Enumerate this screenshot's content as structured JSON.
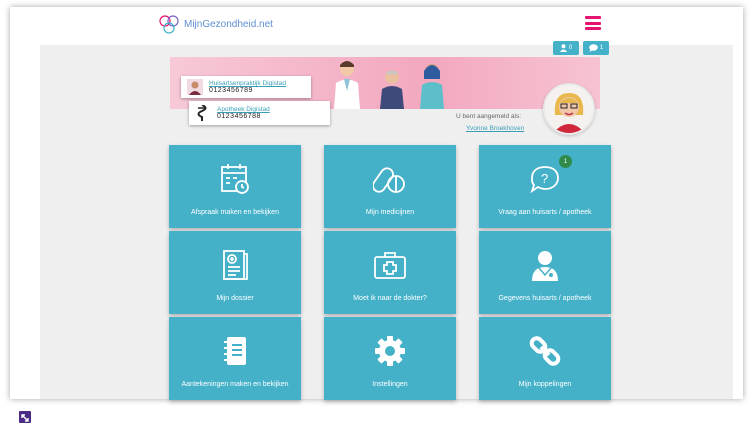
{
  "header": {
    "logo_text": "MijnGezondheid.net",
    "brand_color": "#e5156f",
    "accent_color": "#45b1c9"
  },
  "notifications": {
    "alerts_count": "0",
    "messages_count": "1"
  },
  "contacts": [
    {
      "name": "Huisartsenpraktijk Digistad",
      "phone": "0123456789"
    },
    {
      "name": "Apotheek Digistad",
      "phone": "0123456788"
    }
  ],
  "login": {
    "label": "U bent aangemeld als:",
    "user_name": "Yvonne Broekhoven"
  },
  "tiles": [
    {
      "label": "Afspraak maken en bekijken",
      "icon": "calendar-icon"
    },
    {
      "label": "Mijn medicijnen",
      "icon": "pills-icon"
    },
    {
      "label": "Vraag aan huisarts / apotheek",
      "icon": "question-chat-icon",
      "badge": "1"
    },
    {
      "label": "Mijn dossier",
      "icon": "medical-file-icon"
    },
    {
      "label": "Moet ik naar de dokter?",
      "icon": "first-aid-kit-icon"
    },
    {
      "label": "Gegevens huisarts / apotheek",
      "icon": "doctor-icon"
    },
    {
      "label": "Aantekeningen maken en bekijken",
      "icon": "notebook-icon"
    },
    {
      "label": "Instellingen",
      "icon": "gear-icon"
    },
    {
      "label": "Mijn koppelingen",
      "icon": "link-icon"
    }
  ]
}
